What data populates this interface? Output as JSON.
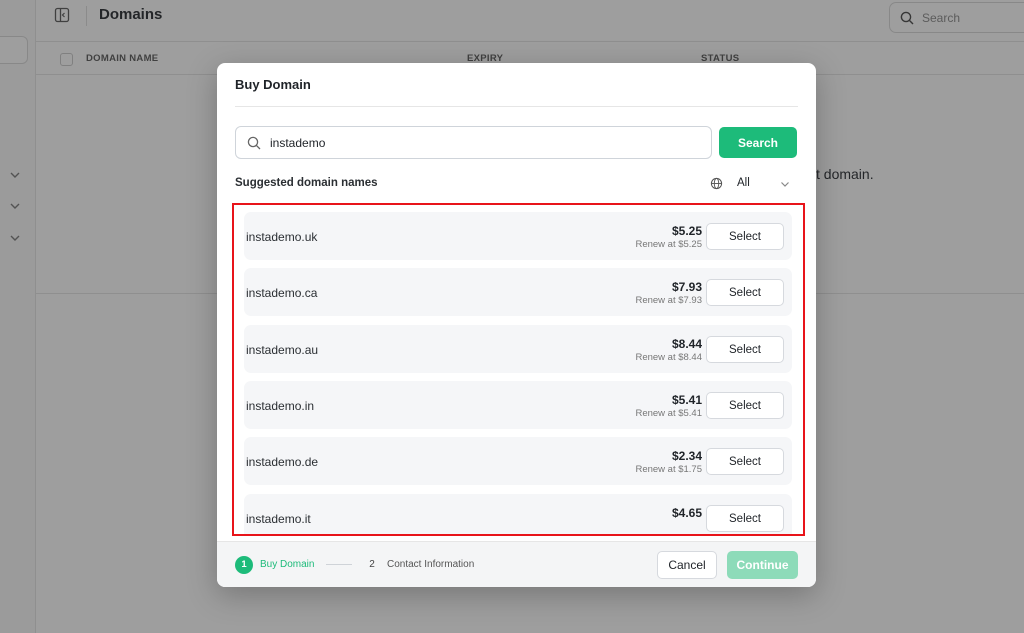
{
  "app": {
    "title": "Domains",
    "search_placeholder": "Search",
    "columns": [
      "DOMAIN NAME",
      "EXPIRY",
      "STATUS"
    ],
    "empty_message_fragment": "t domain."
  },
  "modal": {
    "title": "Buy Domain",
    "search_value": "instademo",
    "search_button": "Search",
    "suggested_label": "Suggested domain names",
    "filter_value": "All",
    "domains": [
      {
        "name": "instademo.uk",
        "price": "$5.25",
        "renew": "Renew at $5.25",
        "action": "Select"
      },
      {
        "name": "instademo.ca",
        "price": "$7.93",
        "renew": "Renew at $7.93",
        "action": "Select"
      },
      {
        "name": "instademo.au",
        "price": "$8.44",
        "renew": "Renew at $8.44",
        "action": "Select"
      },
      {
        "name": "instademo.in",
        "price": "$5.41",
        "renew": "Renew at $5.41",
        "action": "Select"
      },
      {
        "name": "instademo.de",
        "price": "$2.34",
        "renew": "Renew at $1.75",
        "action": "Select"
      },
      {
        "name": "instademo.it",
        "price": "$4.65",
        "renew": "",
        "action": "Select"
      }
    ],
    "steps": [
      {
        "number": "1",
        "label": "Buy Domain"
      },
      {
        "number": "2",
        "label": "Contact Information"
      }
    ],
    "cancel_button": "Cancel",
    "continue_button": "Continue"
  },
  "colors": {
    "accent": "#1dbb7a",
    "highlight_border": "#e8141a"
  },
  "icons": [
    "sidebar-toggle-icon",
    "search-icon",
    "globe-icon",
    "chevron-down-icon"
  ]
}
